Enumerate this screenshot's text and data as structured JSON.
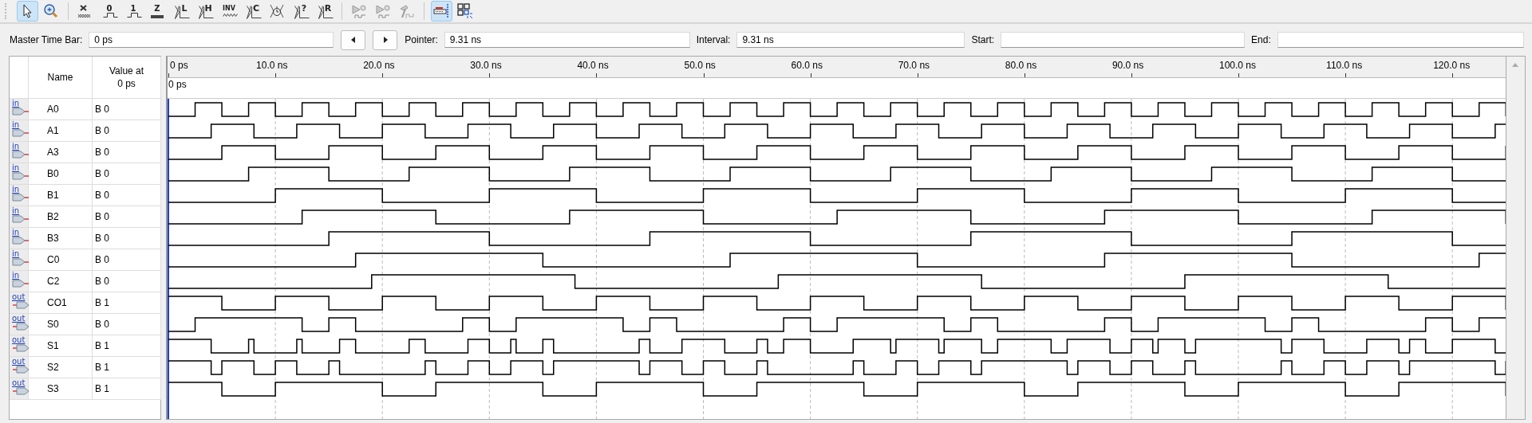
{
  "toolbar": [
    {
      "kind": "pointer",
      "selected": true
    },
    {
      "kind": "zoom",
      "selected": false
    },
    {
      "kind": "unknown",
      "selected": false
    },
    {
      "kind": "glyph",
      "glyph": "0",
      "selected": false
    },
    {
      "kind": "glyph",
      "glyph": "1",
      "selected": false
    },
    {
      "kind": "hiz",
      "glyph": "Z",
      "selected": false
    },
    {
      "kind": "cross",
      "glyph": "L",
      "selected": false
    },
    {
      "kind": "cross",
      "glyph": "H",
      "selected": false
    },
    {
      "kind": "invert",
      "glyph": "INV",
      "selected": false
    },
    {
      "kind": "cross",
      "glyph": "C",
      "selected": false
    },
    {
      "kind": "clock",
      "selected": false
    },
    {
      "kind": "cross",
      "glyph": "?",
      "selected": false
    },
    {
      "kind": "cross",
      "glyph": "R",
      "selected": false
    },
    {
      "kind": "sim",
      "selected": false
    },
    {
      "kind": "sim",
      "selected": false
    },
    {
      "kind": "hammer",
      "selected": false
    },
    {
      "kind": "snap",
      "selected": true
    },
    {
      "kind": "grid",
      "selected": false
    }
  ],
  "time_bar": {
    "master_label": "Master Time Bar:",
    "master_value": "0 ps",
    "pointer_label": "Pointer:",
    "pointer_value": "9.31 ns",
    "interval_label": "Interval:",
    "interval_value": "9.31 ns",
    "start_label": "Start:",
    "end_label": "End:"
  },
  "table": {
    "columns": [
      "Name",
      "Value at 0 ps"
    ],
    "rows": [
      {
        "kind": "in",
        "port": "in",
        "name": "A0",
        "value": "B 0"
      },
      {
        "kind": "in",
        "port": "in",
        "name": "A1",
        "value": "B 0"
      },
      {
        "kind": "in",
        "port": "in",
        "name": "A3",
        "value": "B 0"
      },
      {
        "kind": "in",
        "port": "in",
        "name": "B0",
        "value": "B 0"
      },
      {
        "kind": "in",
        "port": "in",
        "name": "B1",
        "value": "B 0"
      },
      {
        "kind": "in",
        "port": "in",
        "name": "B2",
        "value": "B 0"
      },
      {
        "kind": "in",
        "port": "in",
        "name": "B3",
        "value": "B 0"
      },
      {
        "kind": "in",
        "port": "in",
        "name": "C0",
        "value": "B 0"
      },
      {
        "kind": "in",
        "port": "in",
        "name": "C2",
        "value": "B 0"
      },
      {
        "kind": "out",
        "port": "out",
        "name": "CO1",
        "value": "B 1"
      },
      {
        "kind": "out",
        "port": "out",
        "name": "S0",
        "value": "B 0"
      },
      {
        "kind": "out",
        "port": "out",
        "name": "S1",
        "value": "B 1"
      },
      {
        "kind": "out",
        "port": "out",
        "name": "S2",
        "value": "B 1"
      },
      {
        "kind": "out",
        "port": "out",
        "name": "S3",
        "value": "B 1"
      }
    ]
  },
  "ruler": {
    "ticks": [
      "0 ps",
      "10.0 ns",
      "20.0 ns",
      "30.0 ns",
      "40.0 ns",
      "50.0 ns",
      "60.0 ns",
      "70.0 ns",
      "80.0 ns",
      "90.0 ns",
      "100.0 ns",
      "110.0 ns",
      "120.0 ns"
    ],
    "time_bar_marker": "0 ps"
  }
}
